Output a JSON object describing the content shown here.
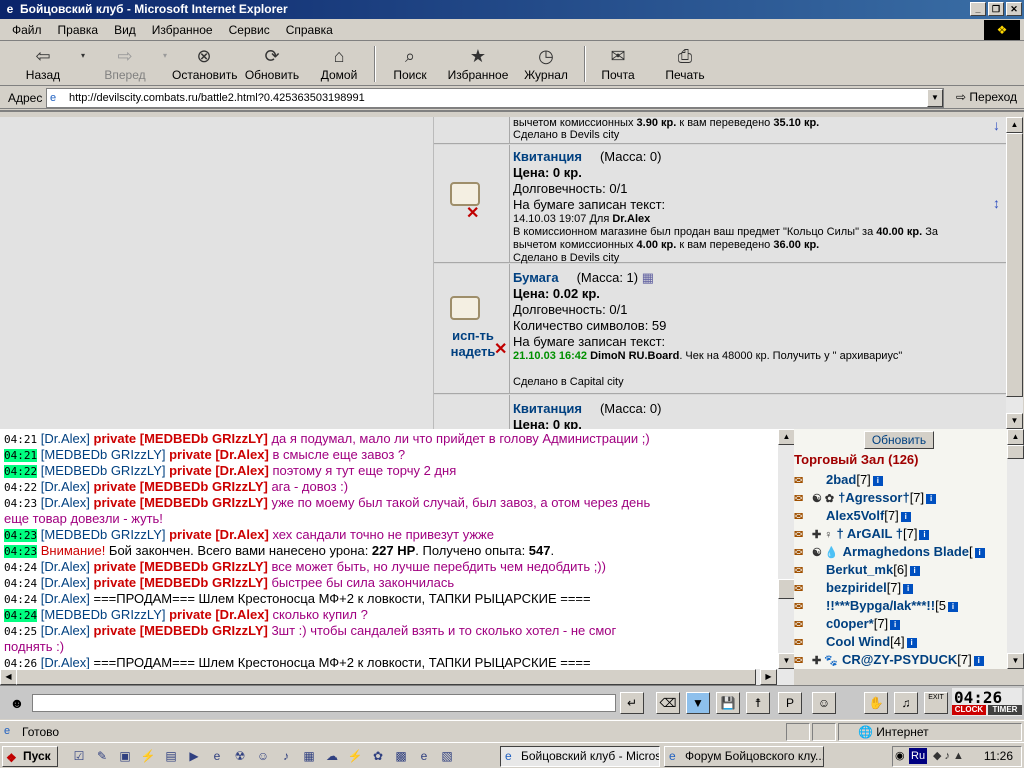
{
  "window": {
    "title": "Бойцовский клуб - Microsoft Internet Explorer",
    "buttons": [
      "_",
      "❐",
      "✕"
    ]
  },
  "menu": [
    "Файл",
    "Правка",
    "Вид",
    "Избранное",
    "Сервис",
    "Справка"
  ],
  "toolbar": {
    "back": "Назад",
    "forward": "Вперед",
    "stop": "Остановить",
    "refresh": "Обновить",
    "home": "Домой",
    "search": "Поиск",
    "favorites": "Избранное",
    "history": "Журнал",
    "mail": "Почта",
    "print": "Печать"
  },
  "address": {
    "label": "Адрес",
    "url": "http://devilscity.combats.ru/battle2.html?0.425363503198991",
    "go": "Переход"
  },
  "inventory": {
    "item0": {
      "line1_pre": "вычетом комиссионных ",
      "line1_fee": "3.90 кр.",
      "line1_mid": " к вам переведено ",
      "line1_amt": "35.10 кр.",
      "made": "Сделано в Devils city"
    },
    "item1": {
      "name": "Квитанция",
      "mass": "(Масса: 0)",
      "price": "Цена: 0 кр.",
      "durability": "Долговечность: 0/1",
      "paper": "На бумаге записан текст:",
      "date": "14.10.03 19:07 Для ",
      "for": "Dr.Alex",
      "line_a": "В комиссионном магазине был продан ваш предмет \"Кольцо Силы\" за ",
      "line_a_amt": "40.00 кр.",
      "line_a_end": " За",
      "line_b_pre": "вычетом комиссионных ",
      "line_b_fee": "4.00 кр.",
      "line_b_mid": " к вам переведено ",
      "line_b_amt": "36.00 кр.",
      "made": "Сделано в Devils city"
    },
    "item2": {
      "name": "Бумага",
      "mass": "(Масса: 1)",
      "price": "Цена: 0.02 кр.",
      "durability": "Долговечность: 0/1",
      "chars": "Количество символов: 59",
      "paper": "На бумаге записан текст:",
      "date": "21.10.03 16:42",
      "author": "DimoN RU.Board",
      "text": ". Чек на 48000 кр. Получить у \" архивариус\"",
      "made": "Сделано в Capital city",
      "action_use": "исп-ть",
      "action_wear": "надеть"
    },
    "item3": {
      "name": "Квитанция",
      "mass": "(Масса: 0)",
      "price": "Цена: 0 кр."
    }
  },
  "chat": [
    {
      "time": "04:21",
      "hl": false,
      "from": "[Dr.Alex]",
      "priv": "private [MEDBEDb GRIzzLY]",
      "msg": "да я подумал, мало ли что прийдет в голову Администрации ;)",
      "mtype": "priv"
    },
    {
      "time": "04:21",
      "hl": true,
      "from": "[MEDBEDb GRIzzLY]",
      "priv": "private [Dr.Alex]",
      "msg": "в смысле еще завоз ?",
      "mtype": "priv"
    },
    {
      "time": "04:22",
      "hl": true,
      "from": "[MEDBEDb GRIzzLY]",
      "priv": "private [Dr.Alex]",
      "msg": "поэтому я тут еще торчу 2 дня",
      "mtype": "priv"
    },
    {
      "time": "04:22",
      "hl": false,
      "from": "[Dr.Alex]",
      "priv": "private [MEDBEDb GRIzzLY]",
      "msg": "ага - довоз :)",
      "mtype": "priv"
    },
    {
      "time": "04:23",
      "hl": false,
      "from": "[Dr.Alex]",
      "priv": "private [MEDBEDb GRIzzLY]",
      "msg": "уже по моему был такой случай, был завоз, а отом через день",
      "mtype": "priv"
    },
    {
      "cont": "еще товар довезли - жуть!"
    },
    {
      "time": "04:23",
      "hl": true,
      "from": "[MEDBEDb GRIzzLY]",
      "priv": "private [Dr.Alex]",
      "msg": "хех сандали точно не привезут ужже",
      "mtype": "priv"
    },
    {
      "time": "04:23",
      "hl": true,
      "warn": "Внимание!",
      "sys": " Бой закончен. Всего вами нанесено урона: ",
      "dmg": "227 HP",
      "sys2": ". Получено опыта: ",
      "exp": "547",
      "end": "."
    },
    {
      "time": "04:24",
      "hl": false,
      "from": "[Dr.Alex]",
      "priv": "private [MEDBEDb GRIzzLY]",
      "msg": "все может быть, но лучше перебдить чем недобдить ;))",
      "mtype": "priv"
    },
    {
      "time": "04:24",
      "hl": false,
      "from": "[Dr.Alex]",
      "priv": "private [MEDBEDb GRIzzLY]",
      "msg": "быстрее бы сила закончилась",
      "mtype": "priv"
    },
    {
      "time": "04:24",
      "hl": false,
      "from": "[Dr.Alex]",
      "priv": "",
      "msg": "===ПРОДАМ=== Шлем Крестоносца МФ+2 к ловкости, ТАПКИ РЫЦАРСКИЕ ====",
      "mtype": "pub"
    },
    {
      "time": "04:24",
      "hl": true,
      "from": "[MEDBEDb GRIzzLY]",
      "priv": "private [Dr.Alex]",
      "msg": "сколько купил ?",
      "mtype": "priv"
    },
    {
      "time": "04:25",
      "hl": false,
      "from": "[Dr.Alex]",
      "priv": "private [MEDBEDb GRIzzLY]",
      "msg": "3шт :) чтобы сандалей взять и то сколько хотел - не смог",
      "mtype": "priv"
    },
    {
      "cont": "поднять :)"
    },
    {
      "time": "04:26",
      "hl": false,
      "from": "[Dr.Alex]",
      "priv": "",
      "msg": "===ПРОДАМ=== Шлем Крестоносца МФ+2 к ловкости, ТАПКИ РЫЦАРСКИЕ ====",
      "mtype": "pub"
    }
  ],
  "users": {
    "refresh": "Обновить",
    "hall": "Торговый Зал (126)",
    "list": [
      {
        "name": "2bad",
        "lvl": "[7]",
        "icons": ""
      },
      {
        "name": "†Agressor†",
        "lvl": "[7]",
        "icons": "☯ ✿"
      },
      {
        "name": "Alex5Volf",
        "lvl": "[7]",
        "icons": ""
      },
      {
        "name": "† ArGAIL †",
        "lvl": "[7]",
        "icons": "✚ ♀"
      },
      {
        "name": "Armaghedons Blade",
        "lvl": "[",
        "icons": "☯ 💧"
      },
      {
        "name": "Berkut_mk",
        "lvl": "[6]",
        "icons": ""
      },
      {
        "name": "bezpiridel",
        "lvl": "[7]",
        "icons": ""
      },
      {
        "name": "!!***Bypga/Iak***!!",
        "lvl": "[5",
        "icons": ""
      },
      {
        "name": "c0oper*",
        "lvl": "[7]",
        "icons": ""
      },
      {
        "name": "Cool Wind",
        "lvl": "[4]",
        "icons": ""
      },
      {
        "name": "CR@ZY-PSYDUCK",
        "lvl": "[7]",
        "icons": "✚ 🐾"
      }
    ]
  },
  "chatbar": {
    "time": "04:26",
    "clock": "CLOCK",
    "timer": "TIMER",
    "exit": "EXIT"
  },
  "status": {
    "text": "Готово",
    "zone": "Интернет"
  },
  "taskbar": {
    "start": "Пуск",
    "tasks": [
      "Бойцовский клуб - Micros...",
      "Форум Бойцовского клу..."
    ],
    "lang": "Ru",
    "time": "11:26"
  }
}
